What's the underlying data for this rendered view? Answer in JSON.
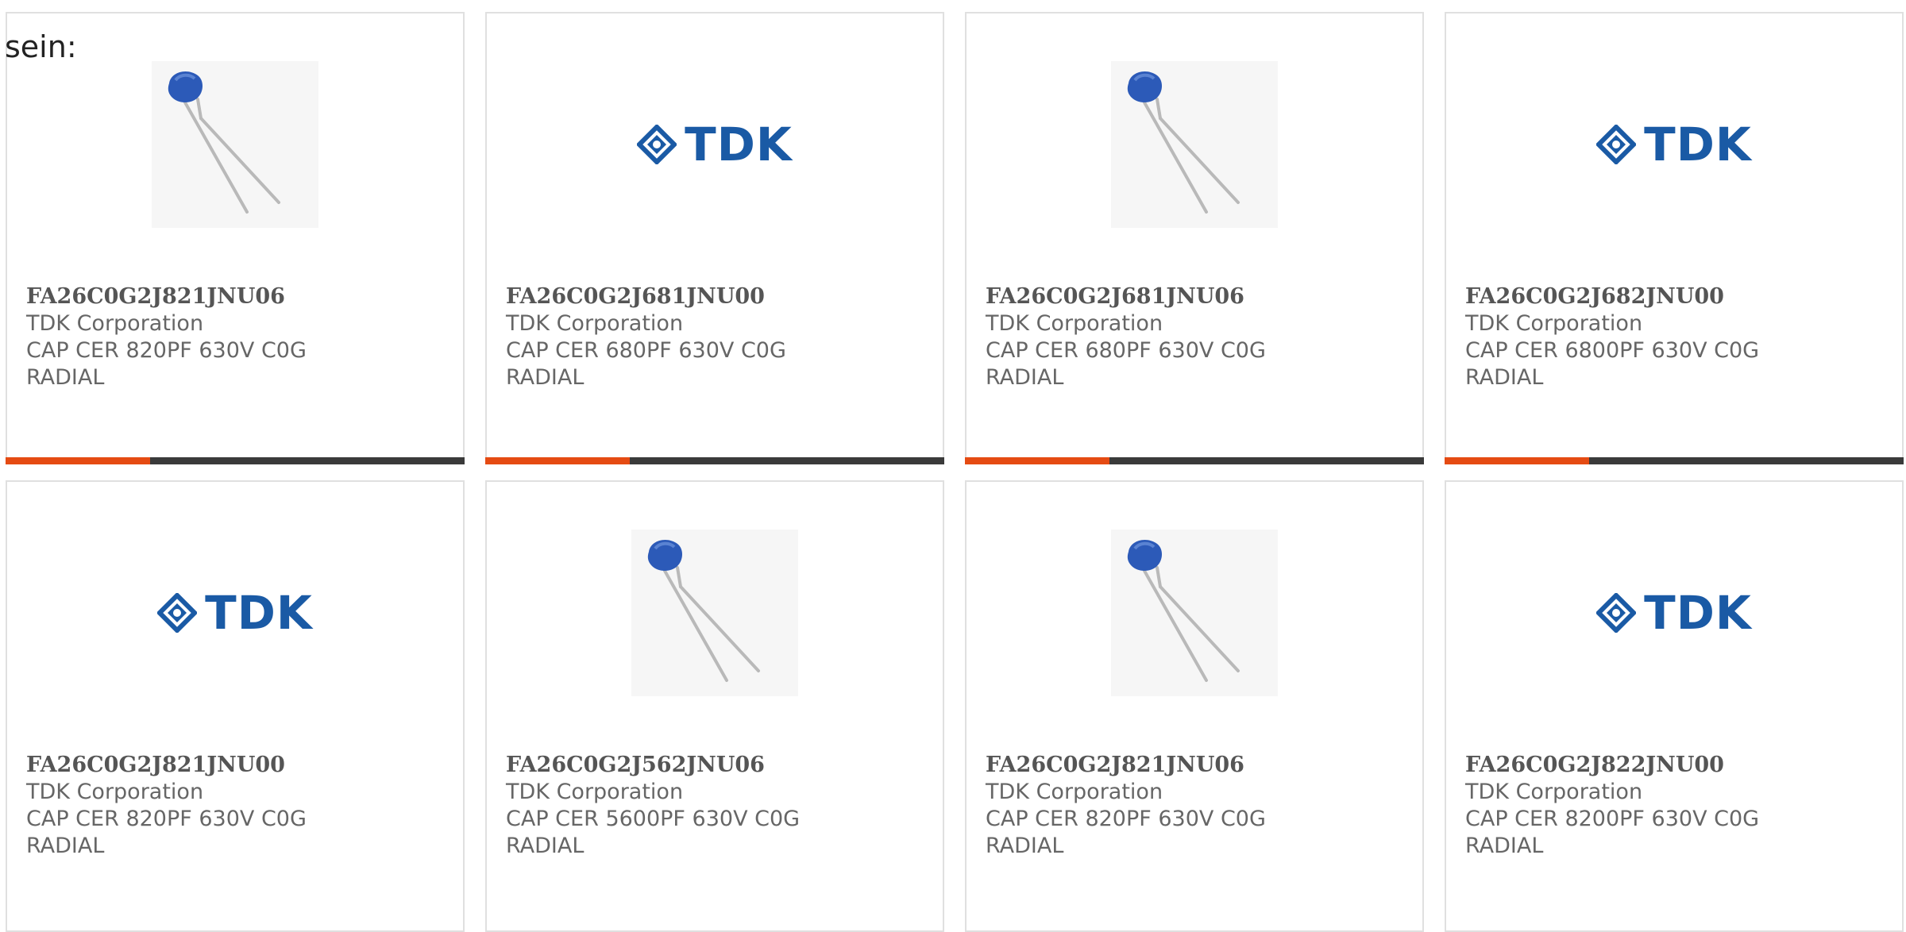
{
  "intro_text": "sein:",
  "colors": {
    "card_border": "#e0e0e0",
    "accent_bar": "#e54b13",
    "dark_bar": "#3a3a3a",
    "tdk_blue": "#1a5aa5"
  },
  "products": [
    {
      "part": "FA26C0G2J821JNU06",
      "maker": "TDK Corporation",
      "desc1": "CAP CER 820PF 630V C0G",
      "desc2": "RADIAL",
      "image": "capacitor-photo",
      "bar": true
    },
    {
      "part": "FA26C0G2J681JNU00",
      "maker": "TDK Corporation",
      "desc1": "CAP CER 680PF 630V C0G",
      "desc2": "RADIAL",
      "image": "tdk-logo",
      "logo_text": "TDK",
      "bar": true
    },
    {
      "part": "FA26C0G2J681JNU06",
      "maker": "TDK Corporation",
      "desc1": "CAP CER 680PF 630V C0G",
      "desc2": "RADIAL",
      "image": "capacitor-photo",
      "bar": true
    },
    {
      "part": "FA26C0G2J682JNU00",
      "maker": "TDK Corporation",
      "desc1": "CAP CER 6800PF 630V C0G",
      "desc2": "RADIAL",
      "image": "tdk-logo",
      "logo_text": "TDK",
      "bar": true
    },
    {
      "part": "FA26C0G2J821JNU00",
      "maker": "TDK Corporation",
      "desc1": "CAP CER 820PF 630V C0G",
      "desc2": "RADIAL",
      "image": "tdk-logo",
      "logo_text": "TDK",
      "bar": false
    },
    {
      "part": "FA26C0G2J562JNU06",
      "maker": "TDK Corporation",
      "desc1": "CAP CER 5600PF 630V C0G",
      "desc2": "RADIAL",
      "image": "capacitor-photo",
      "bar": false
    },
    {
      "part": "FA26C0G2J821JNU06",
      "maker": "TDK Corporation",
      "desc1": "CAP CER 820PF 630V C0G",
      "desc2": "RADIAL",
      "image": "capacitor-photo",
      "bar": false
    },
    {
      "part": "FA26C0G2J822JNU00",
      "maker": "TDK Corporation",
      "desc1": "CAP CER 8200PF 630V C0G",
      "desc2": "RADIAL",
      "image": "tdk-logo",
      "logo_text": "TDK",
      "bar": false
    }
  ]
}
